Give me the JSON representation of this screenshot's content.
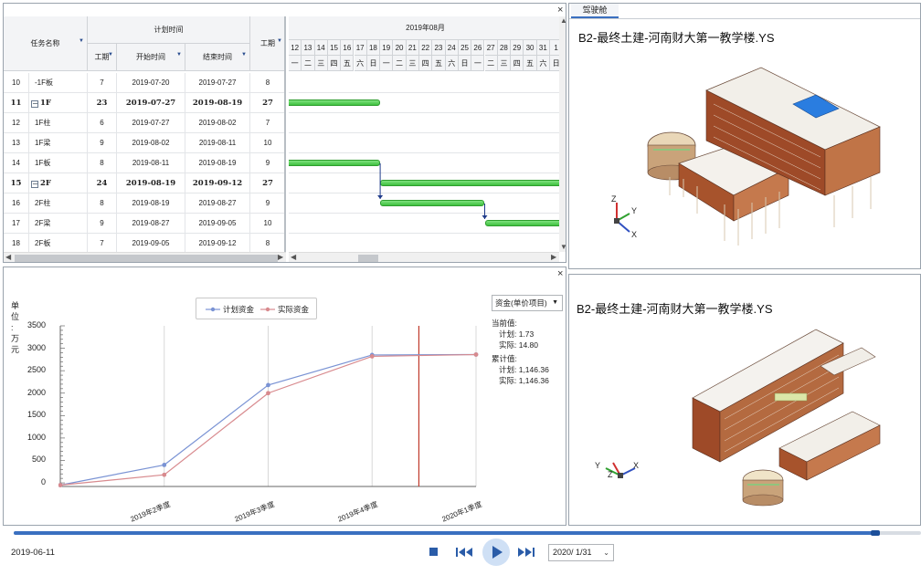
{
  "gantt": {
    "header": {
      "task_name": "任务名称",
      "plan_time": "计划时间",
      "duration": "工期",
      "start": "开始时间",
      "end": "结束时间",
      "duration2": "工期",
      "month": "2019年08月"
    },
    "days": [
      "12",
      "13",
      "14",
      "15",
      "16",
      "17",
      "18",
      "19",
      "20",
      "21",
      "22",
      "23",
      "24",
      "25",
      "26",
      "27",
      "28",
      "29",
      "30",
      "31",
      "1"
    ],
    "weekdays": [
      "一",
      "二",
      "三",
      "四",
      "五",
      "六",
      "日",
      "一",
      "二",
      "三",
      "四",
      "五",
      "六",
      "日",
      "一",
      "二",
      "三",
      "四",
      "五",
      "六",
      "日"
    ],
    "rows": [
      {
        "no": "10",
        "name": "-1F板",
        "dur": "7",
        "start": "2019-07-20",
        "end": "2019-07-27",
        "dur2": "8",
        "bold": false,
        "group": false
      },
      {
        "no": "11",
        "name": "1F",
        "dur": "23",
        "start": "2019-07-27",
        "end": "2019-08-19",
        "dur2": "27",
        "bold": true,
        "group": true
      },
      {
        "no": "12",
        "name": "1F柱",
        "dur": "6",
        "start": "2019-07-27",
        "end": "2019-08-02",
        "dur2": "7",
        "bold": false,
        "group": false
      },
      {
        "no": "13",
        "name": "1F梁",
        "dur": "9",
        "start": "2019-08-02",
        "end": "2019-08-11",
        "dur2": "10",
        "bold": false,
        "group": false
      },
      {
        "no": "14",
        "name": "1F板",
        "dur": "8",
        "start": "2019-08-11",
        "end": "2019-08-19",
        "dur2": "9",
        "bold": false,
        "group": false
      },
      {
        "no": "15",
        "name": "2F",
        "dur": "24",
        "start": "2019-08-19",
        "end": "2019-09-12",
        "dur2": "27",
        "bold": true,
        "group": true
      },
      {
        "no": "16",
        "name": "2F柱",
        "dur": "8",
        "start": "2019-08-19",
        "end": "2019-08-27",
        "dur2": "9",
        "bold": false,
        "group": false
      },
      {
        "no": "17",
        "name": "2F梁",
        "dur": "9",
        "start": "2019-08-27",
        "end": "2019-09-05",
        "dur2": "10",
        "bold": false,
        "group": false
      },
      {
        "no": "18",
        "name": "2F板",
        "dur": "7",
        "start": "2019-09-05",
        "end": "2019-09-12",
        "dur2": "8",
        "bold": false,
        "group": false
      }
    ],
    "bar_color": "#4cc94c"
  },
  "cost": {
    "unit_label": [
      "单",
      "位",
      ":",
      "万",
      "元"
    ],
    "legend_plan": "计划资金",
    "legend_actual": "实际资金",
    "dropdown": "资金(单价项目)",
    "current_label": "当前值:",
    "current_plan": "计划:  1.73",
    "current_actual": "实际:  14.80",
    "cum_label": "累计值:",
    "cum_plan": "计划:  1,146.36",
    "cum_actual": "实际:  1,146.36",
    "plan_color": "#7a93d4",
    "actual_color": "#d88a8e"
  },
  "chart_data": {
    "type": "line",
    "x": [
      "",
      "2019年2季度",
      "2019年3季度",
      "2019年4季度",
      "2020年1季度"
    ],
    "yticks": [
      "3500",
      "3000",
      "2500",
      "2000",
      "1500",
      "1000",
      "500",
      "0"
    ],
    "ylim": [
      0,
      3500
    ],
    "series": [
      {
        "name": "计划资金",
        "values": [
          -50,
          400,
          2180,
          2850,
          2860
        ]
      },
      {
        "name": "实际资金",
        "values": [
          -50,
          180,
          2000,
          2820,
          2860
        ]
      }
    ],
    "current_marker_x": 3.45
  },
  "model_top": {
    "tab": "驾驶舱",
    "title": "B2-最终土建-河南财大第一教学楼.YS",
    "axis_x": "X",
    "axis_y": "Y",
    "axis_z": "Z"
  },
  "model_bottom": {
    "title": "B2-最终土建-河南财大第一教学楼.YS",
    "axis_x": "X",
    "axis_y": "Y",
    "axis_z": "Z"
  },
  "player": {
    "date": "2019-06-11",
    "period": "2020/  1/31",
    "progress": 0.95
  }
}
